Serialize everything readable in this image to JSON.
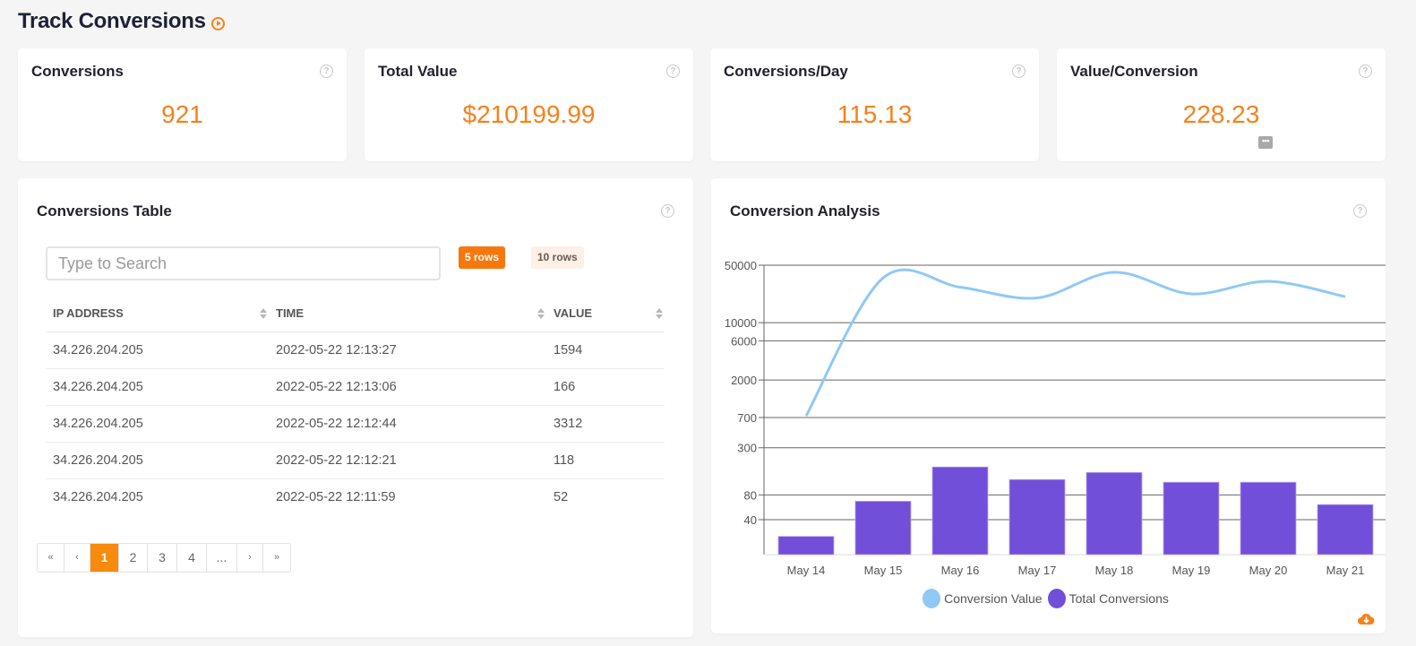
{
  "page": {
    "title": "Track Conversions",
    "title_icon": "play-circle-icon"
  },
  "stats": [
    {
      "title": "Conversions",
      "value": "921"
    },
    {
      "title": "Total Value",
      "value": "$210199.99"
    },
    {
      "title": "Conversions/Day",
      "value": "115.13"
    },
    {
      "title": "Value/Conversion",
      "value": "228.23"
    }
  ],
  "table_panel": {
    "title": "Conversions Table",
    "search_placeholder": "Type to Search",
    "search_value": "",
    "rows_options": [
      "5 rows",
      "10 rows"
    ],
    "selected_rows": "5 rows",
    "columns": [
      "IP ADDRESS",
      "TIME",
      "VALUE"
    ],
    "rows": [
      [
        "34.226.204.205",
        "2022-05-22 12:13:27",
        "1594"
      ],
      [
        "34.226.204.205",
        "2022-05-22 12:13:06",
        "166"
      ],
      [
        "34.226.204.205",
        "2022-05-22 12:12:44",
        "3312"
      ],
      [
        "34.226.204.205",
        "2022-05-22 12:12:21",
        "118"
      ],
      [
        "34.226.204.205",
        "2022-05-22 12:11:59",
        "52"
      ]
    ],
    "pagination": {
      "first": "«",
      "prev": "‹",
      "pages": [
        "1",
        "2",
        "3",
        "4",
        "..."
      ],
      "current": "1",
      "next": "›",
      "last": "»"
    }
  },
  "chart_panel": {
    "title": "Conversion Analysis"
  },
  "chart_data": {
    "type": "bar",
    "title": "Conversion Analysis",
    "xlabel": "",
    "ylabel": "",
    "yscale": "log",
    "ylim": [
      15,
      50000
    ],
    "yticks": [
      50000,
      10000,
      6000,
      2000,
      700,
      300,
      80,
      40
    ],
    "grid": true,
    "categories": [
      "May 14",
      "May 15",
      "May 16",
      "May 17",
      "May 18",
      "May 19",
      "May 20",
      "May 21"
    ],
    "series": [
      {
        "name": "Conversion Value",
        "type": "line",
        "color": "#90c9f4",
        "values": [
          730,
          35000,
          27000,
          20000,
          41000,
          22400,
          31800,
          20700
        ]
      },
      {
        "name": "Total Conversions",
        "type": "bar",
        "color": "#724fd8",
        "values": [
          25,
          67,
          175,
          123,
          150,
          114,
          114,
          61
        ]
      }
    ],
    "legend": "bottom-center"
  },
  "colors": {
    "accent": "#f7811a",
    "bar": "#724fd8",
    "line": "#90c9f4"
  }
}
